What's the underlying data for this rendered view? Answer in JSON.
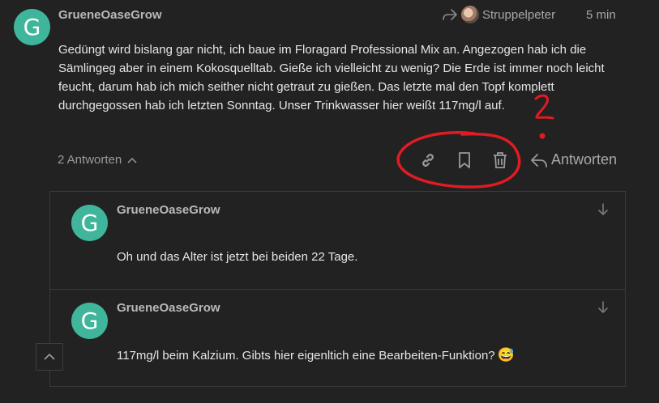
{
  "post": {
    "avatar_letter": "G",
    "username": "GrueneOaseGrow",
    "reply_to_user": "Struppelpeter",
    "time": "5 min",
    "text": "Gedüngt wird bislang gar nicht, ich baue im Floragard Professional Mix an. Angezogen hab ich die Sämlingeg aber in einem Kokosquelltab. Gieße ich vielleicht zu wenig? Die Erde ist immer noch leicht feucht, darum hab ich mich seither nicht getraut zu gießen. Das letzte mal den Topf komplett durchgegossen hab ich letzten Sonntag. Unser Trinkwasser hier weißt 117mg/l auf.",
    "replies_toggle": "2 Antworten",
    "reply_button": "Antworten"
  },
  "replies": [
    {
      "avatar_letter": "G",
      "username": "GrueneOaseGrow",
      "text": "Oh und das Alter ist jetzt bei beiden 22 Tage."
    },
    {
      "avatar_letter": "G",
      "username": "GrueneOaseGrow",
      "text": "117mg/l beim Kalzium. Gibts hier eigenltich eine Bearbeiten-Funktion?",
      "emoji": "😅"
    }
  ],
  "colors": {
    "background": "#222222",
    "avatar": "#3fb69b",
    "annotation": "#e01b24"
  },
  "icons": [
    "reply-arrow-icon",
    "link-icon",
    "bookmark-icon",
    "trash-icon",
    "chevron-up-icon",
    "arrow-down-icon"
  ]
}
